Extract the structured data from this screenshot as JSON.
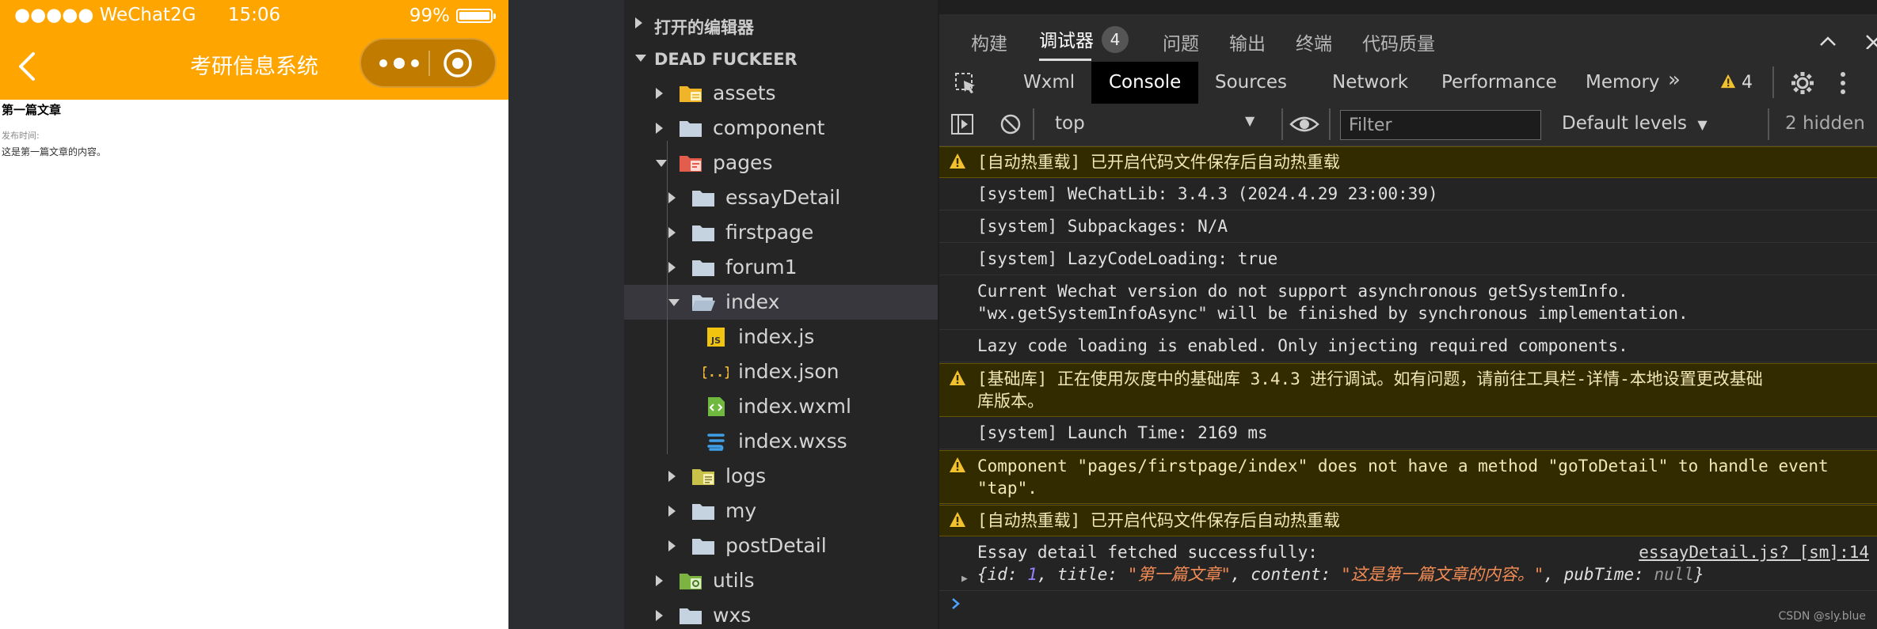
{
  "phone": {
    "status": {
      "signal": "●●●●● WeChat2G",
      "time": "15:06",
      "battery_text": "99%",
      "battery_level": 0.99
    },
    "nav_title": "考研信息系统",
    "content": {
      "title": "第一篇文章",
      "date_label": "发布时间:",
      "body": "这是第一篇文章的内容。"
    }
  },
  "explorer": {
    "open_editors": "打开的编辑器",
    "project": "DEAD FUCKEER",
    "items": [
      {
        "label": "assets",
        "icon": "assets-folder-icon"
      },
      {
        "label": "component",
        "icon": "folder-icon"
      },
      {
        "label": "pages",
        "icon": "pages-folder-icon"
      },
      {
        "label": "essayDetail",
        "icon": "folder-icon"
      },
      {
        "label": "firstpage",
        "icon": "folder-icon"
      },
      {
        "label": "forum1",
        "icon": "folder-icon"
      },
      {
        "label": "index",
        "icon": "folder-open-icon"
      },
      {
        "label": "index.js",
        "icon": "js-file-icon"
      },
      {
        "label": "index.json",
        "icon": "json-file-icon"
      },
      {
        "label": "index.wxml",
        "icon": "wxml-file-icon"
      },
      {
        "label": "index.wxss",
        "icon": "wxss-file-icon"
      },
      {
        "label": "logs",
        "icon": "logs-folder-icon"
      },
      {
        "label": "my",
        "icon": "folder-icon"
      },
      {
        "label": "postDetail",
        "icon": "folder-icon"
      },
      {
        "label": "utils",
        "icon": "utils-folder-icon"
      },
      {
        "label": "wxs",
        "icon": "folder-icon"
      }
    ]
  },
  "devtools": {
    "tabs": [
      "构建",
      "调试器",
      "问题",
      "输出",
      "终端",
      "代码质量"
    ],
    "debug_badge": "4",
    "panels": [
      "Wxml",
      "Console",
      "Sources",
      "Network",
      "Performance",
      "Memory"
    ],
    "warn_count": "4",
    "context": "top",
    "filter_placeholder": "Filter",
    "levels": "Default levels",
    "hidden": "2 hidden",
    "logs": [
      {
        "type": "warn",
        "text": "[自动热重载] 已开启代码文件保存后自动热重载"
      },
      {
        "type": "info",
        "text": "[system] WeChatLib: 3.4.3 (2024.4.29 23:00:39)"
      },
      {
        "type": "info",
        "text": "[system] Subpackages: N/A"
      },
      {
        "type": "info",
        "text": "[system] LazyCodeLoading: true"
      },
      {
        "type": "info",
        "text": "Current Wechat version do not support asynchronous getSystemInfo.\n\"wx.getSystemInfoAsync\" will be finished by synchronous implementation."
      },
      {
        "type": "info",
        "text": "Lazy code loading is enabled. Only injecting required components."
      },
      {
        "type": "warn",
        "text": "[基础库] 正在使用灰度中的基础库 3.4.3 进行调试。如有问题，请前往工具栏-详情-本地设置更改基础\n库版本。"
      },
      {
        "type": "info",
        "text": "[system] Launch Time: 2169 ms"
      },
      {
        "type": "warn",
        "text": "Component \"pages/firstpage/index\" does not have a method \"goToDetail\" to handle event\n\"tap\"."
      },
      {
        "type": "warn",
        "text": "[自动热重载] 已开启代码文件保存后自动热重载"
      },
      {
        "type": "info",
        "text": "Essay detail fetched successfully:"
      }
    ],
    "source_link": "essayDetail.js? [sm]:14",
    "object": {
      "open": "{",
      "close": "}",
      "id_key": "id: ",
      "id_val": "1",
      "title_key": ", title: ",
      "title_val": "\"第一篇文章\"",
      "content_key": ", content: ",
      "content_val": "\"这是第一篇文章的内容。\"",
      "pub_key": ", pubTime: ",
      "pub_val": "null"
    },
    "watermark": "CSDN @sly.blue"
  },
  "colors": {
    "accent_orange": "#ffa500",
    "warn_yellow": "#f2c12e",
    "link_blue": "#4ea1ff"
  }
}
